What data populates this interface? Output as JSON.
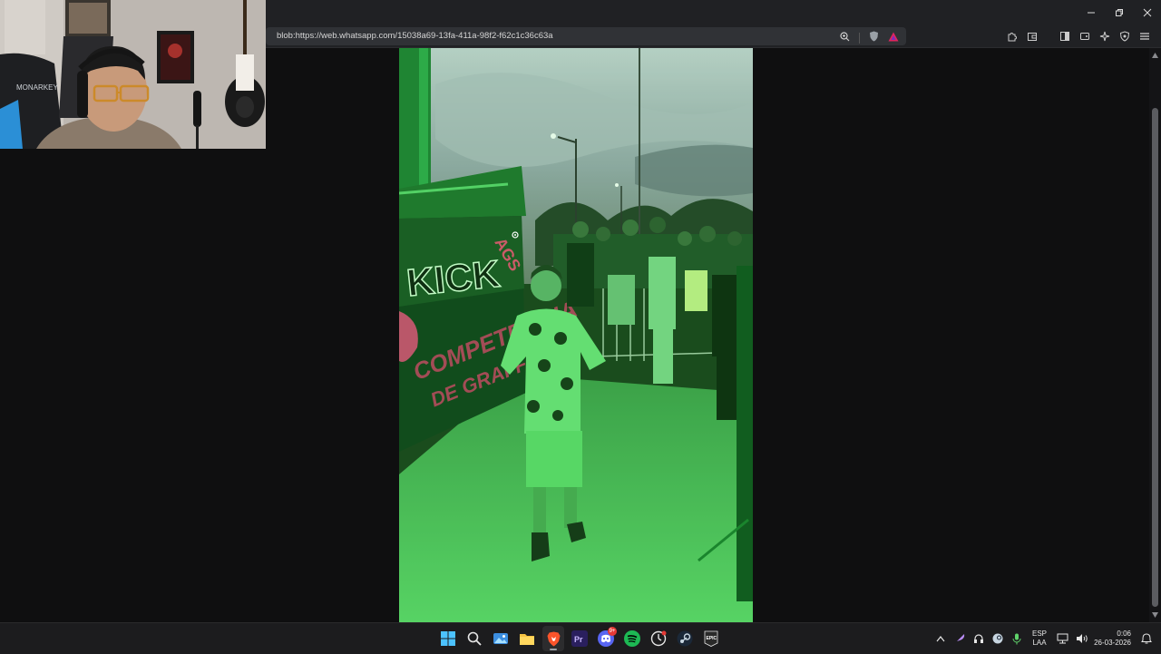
{
  "browser": {
    "url": "blob:https://web.whatsapp.com/15038a69-13fa-411a-98f2-f62c1c36c63a"
  },
  "photo": {
    "wall_text_1": "KICK",
    "wall_text_2": "COMPETENCIA",
    "wall_text_3": "DE GRAFFITI",
    "sticker_text": "AGS"
  },
  "webcam": {
    "chair_brand": "MONARKEY"
  },
  "taskbar": {
    "apps": [
      {
        "name": "start-icon"
      },
      {
        "name": "search-icon"
      },
      {
        "name": "photos-icon"
      },
      {
        "name": "file-explorer-icon"
      },
      {
        "name": "brave-icon"
      },
      {
        "name": "premiere-icon",
        "label": "Pr"
      },
      {
        "name": "discord-icon",
        "badge": "9+"
      },
      {
        "name": "spotify-icon"
      },
      {
        "name": "clock-app-icon"
      },
      {
        "name": "steam-icon"
      },
      {
        "name": "epic-icon",
        "label": "EPIC"
      }
    ],
    "language_top": "ESP",
    "language_bottom": "LAA",
    "time": "0:06",
    "date": "26-03-2026"
  },
  "colors": {
    "accent_brave": "#fb542b",
    "spotify": "#1db954",
    "discord": "#5865f2",
    "premiere": "#2a1f5e"
  }
}
